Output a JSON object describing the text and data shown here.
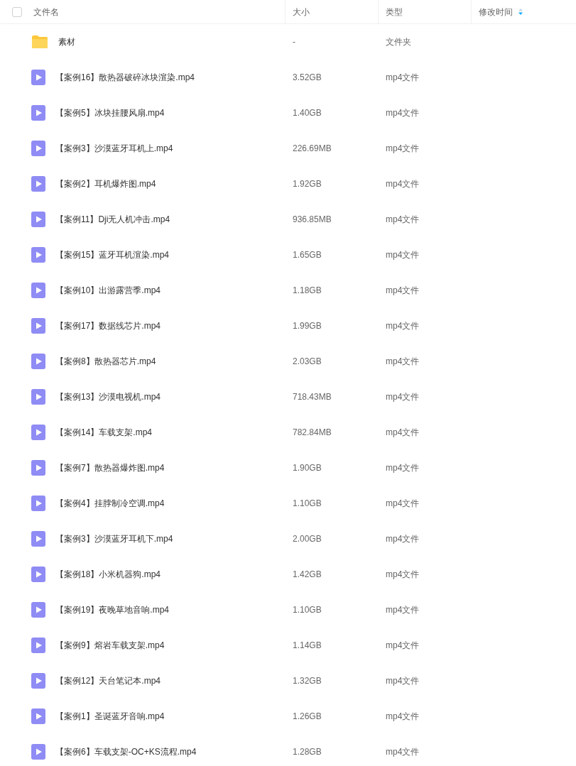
{
  "header": {
    "checked": false,
    "columns": [
      {
        "label": "文件名"
      },
      {
        "label": "大小"
      },
      {
        "label": "类型"
      },
      {
        "label": "修改时间",
        "sortable": true
      }
    ]
  },
  "rows": [
    {
      "kind": "folder",
      "name": "素材",
      "size": "-",
      "type": "文件夹"
    },
    {
      "kind": "video",
      "name": "【案例16】散热器破碎冰块渲染.mp4",
      "size": "3.52GB",
      "type": "mp4文件"
    },
    {
      "kind": "video",
      "name": "【案例5】冰块挂腰风扇.mp4",
      "size": "1.40GB",
      "type": "mp4文件"
    },
    {
      "kind": "video",
      "name": "【案例3】沙漠蓝牙耳机上.mp4",
      "size": "226.69MB",
      "type": "mp4文件"
    },
    {
      "kind": "video",
      "name": "【案例2】耳机爆炸图.mp4",
      "size": "1.92GB",
      "type": "mp4文件"
    },
    {
      "kind": "video",
      "name": "【案例11】Dji无人机冲击.mp4",
      "size": "936.85MB",
      "type": "mp4文件"
    },
    {
      "kind": "video",
      "name": "【案例15】蓝牙耳机渲染.mp4",
      "size": "1.65GB",
      "type": "mp4文件"
    },
    {
      "kind": "video",
      "name": "【案例10】出游露营季.mp4",
      "size": "1.18GB",
      "type": "mp4文件"
    },
    {
      "kind": "video",
      "name": "【案例17】数据线芯片.mp4",
      "size": "1.99GB",
      "type": "mp4文件"
    },
    {
      "kind": "video",
      "name": "【案例8】散热器芯片.mp4",
      "size": "2.03GB",
      "type": "mp4文件"
    },
    {
      "kind": "video",
      "name": "【案例13】沙漠电视机.mp4",
      "size": "718.43MB",
      "type": "mp4文件"
    },
    {
      "kind": "video",
      "name": "【案例14】车载支架.mp4",
      "size": "782.84MB",
      "type": "mp4文件"
    },
    {
      "kind": "video",
      "name": "【案例7】散热器爆炸图.mp4",
      "size": "1.90GB",
      "type": "mp4文件"
    },
    {
      "kind": "video",
      "name": "【案例4】挂脖制冷空调.mp4",
      "size": "1.10GB",
      "type": "mp4文件"
    },
    {
      "kind": "video",
      "name": "【案例3】沙漠蓝牙耳机下.mp4",
      "size": "2.00GB",
      "type": "mp4文件"
    },
    {
      "kind": "video",
      "name": "【案例18】小米机器狗.mp4",
      "size": "1.42GB",
      "type": "mp4文件"
    },
    {
      "kind": "video",
      "name": "【案例19】夜晚草地音响.mp4",
      "size": "1.10GB",
      "type": "mp4文件"
    },
    {
      "kind": "video",
      "name": "【案例9】熔岩车载支架.mp4",
      "size": "1.14GB",
      "type": "mp4文件"
    },
    {
      "kind": "video",
      "name": "【案例12】天台笔记本.mp4",
      "size": "1.32GB",
      "type": "mp4文件"
    },
    {
      "kind": "video",
      "name": "【案例1】圣诞蓝牙音响.mp4",
      "size": "1.26GB",
      "type": "mp4文件"
    },
    {
      "kind": "video",
      "name": "【案例6】车载支架-OC+KS流程.mp4",
      "size": "1.28GB",
      "type": "mp4文件"
    }
  ]
}
